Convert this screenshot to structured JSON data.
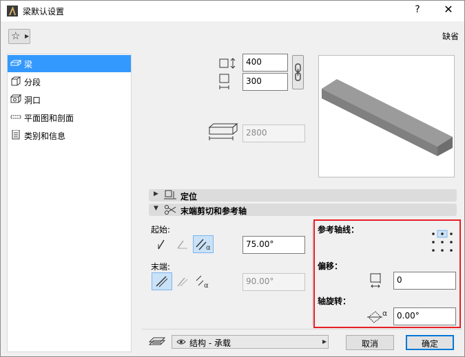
{
  "window": {
    "title": "梁默认设置",
    "help": "?",
    "close": "✕"
  },
  "toolbar": {
    "default_label": "缺省"
  },
  "sidebar": {
    "items": [
      {
        "label": "梁",
        "icon": "beam-icon",
        "selected": true
      },
      {
        "label": "分段",
        "icon": "segment-icon",
        "selected": false
      },
      {
        "label": "洞口",
        "icon": "hole-icon",
        "selected": false
      },
      {
        "label": "平面图和剖面",
        "icon": "floorplan-section-icon",
        "selected": false
      },
      {
        "label": "类别和信息",
        "icon": "classification-icon",
        "selected": false
      }
    ]
  },
  "geometry": {
    "height": "400",
    "width": "300",
    "length": "2800"
  },
  "sections": {
    "positioning": "定位",
    "end_cut": "末端剪切和参考轴"
  },
  "end_cut": {
    "start_label": "起始:",
    "start_angle": "75.00°",
    "end_label": "末端:",
    "end_angle": "90.00°"
  },
  "reference_axis": {
    "axis_label": "参考轴线：",
    "offset_label": "偏移：",
    "offset_value": "0",
    "rotation_label": "轴旋转：",
    "rotation_value": "0.00°"
  },
  "footer": {
    "layer": "结构 - 承载",
    "cancel": "取消",
    "ok": "确定"
  },
  "colors": {
    "selection": "#3399ff",
    "highlight_box": "#e81c23",
    "primary_border": "#0078d7"
  }
}
